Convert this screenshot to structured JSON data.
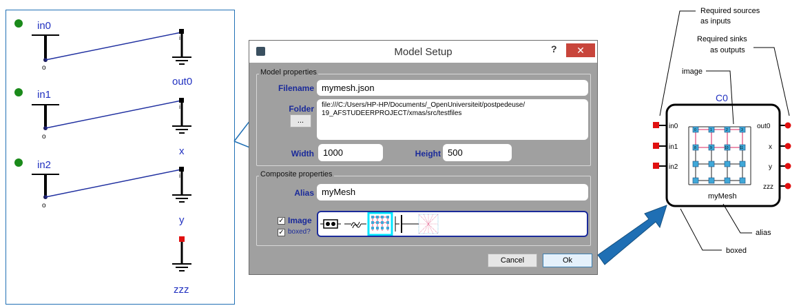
{
  "left_panel": {
    "inputs": [
      "in0",
      "in1",
      "in2"
    ],
    "outputs": [
      "out0",
      "x",
      "y",
      "zzz"
    ],
    "pin_out_label": "o",
    "pin_in_label": "i"
  },
  "dialog": {
    "title": "Model Setup",
    "help_label": "?",
    "close_label": "✕",
    "model_group_title": "Model properties",
    "filename_label": "Filename",
    "filename_value": "mymesh.json",
    "folder_label": "Folder",
    "folder_value_line1": "file:///C:/Users/HP-HP/Documents/_OpenUniversiteit/postpedeuse/",
    "folder_value_line2": "19_AFSTUDEERPROJECT/xmas/src/testfiles",
    "browse_label": "...",
    "width_label": "Width",
    "width_value": "1000",
    "height_label": "Height",
    "height_value": "500",
    "composite_group_title": "Composite properties",
    "alias_label": "Alias",
    "alias_value": "myMesh",
    "image_label": "Image",
    "image_checked": true,
    "boxed_label": "boxed?",
    "boxed_checked": true,
    "cancel_label": "Cancel",
    "ok_label": "Ok",
    "check_mark": "✓"
  },
  "component": {
    "name": "C0",
    "alias": "myMesh",
    "inputs": [
      "in0",
      "in1",
      "in2"
    ],
    "outputs": [
      "out0",
      "x",
      "y",
      "zzz"
    ],
    "mesh_node_labels": [
      "0",
      "1",
      "2",
      "3",
      "8",
      "9",
      "10",
      "11"
    ]
  },
  "annotations": {
    "sources_line1": "Required sources",
    "sources_line2": "as inputs",
    "sinks_line1": "Required sinks",
    "sinks_line2": "as outputs",
    "image": "image",
    "alias": "alias",
    "boxed": "boxed"
  },
  "colors": {
    "accent_blue": "#1f6fb4",
    "port_label_blue": "#2030c0",
    "green_dot": "#1a8a1a",
    "red_port": "#e01010",
    "mesh_pink": "#e05080",
    "mesh_node": "#40a8d8",
    "dialog_gray": "#a0a0a0"
  }
}
